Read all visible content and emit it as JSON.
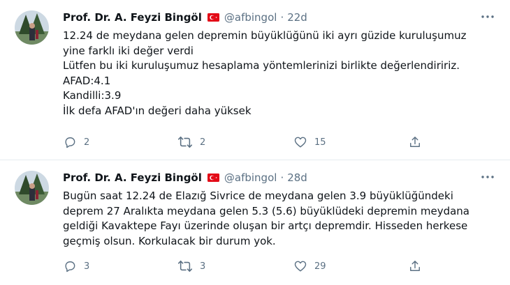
{
  "colors": {
    "text": "#0f1419",
    "secondary": "#5b7083",
    "divider": "#e6ecf0",
    "flag": "#e30a17"
  },
  "tweets": [
    {
      "author_name": "Prof. Dr. A. Feyzi Bingöl",
      "handle": "@afbingol",
      "separator": "·",
      "time": "22d",
      "lines": [
        "12.24 de meydana gelen depremin büyüklüğünü iki ayrı güzide kuruluşumuz",
        "yine farklı iki değer verdi",
        "Lütfen bu iki kuruluşumuz hesaplama yöntemlerinizi birlikte değerlendiririz.",
        "AFAD:4.1",
        "Kandilli:3.9",
        "İlk defa AFAD'ın değeri daha yüksek"
      ],
      "replies": "2",
      "retweets": "2",
      "likes": "15"
    },
    {
      "author_name": "Prof. Dr. A. Feyzi Bingöl",
      "handle": "@afbingol",
      "separator": "·",
      "time": "28d",
      "lines": [
        "Bugün saat 12.24 de Elazığ Sivrice de meydana gelen 3.9 büyüklüğündeki",
        "deprem 27 Aralıkta meydana gelen 5.3 (5.6) büyüklüdeki depremin meydana",
        "geldiği Kavaktepe Fayı üzerinde oluşan bir artçı depremdir. Hisseden herkese",
        "geçmiş olsun. Korkulacak bir durum yok."
      ],
      "replies": "3",
      "retweets": "3",
      "likes": "29"
    }
  ],
  "icons": {
    "avatar": "profile-photo",
    "flag": "turkey-flag",
    "more": "more-dots",
    "reply": "reply-bubble",
    "retweet": "retweet-arrows",
    "like": "heart",
    "share": "share-upload"
  }
}
